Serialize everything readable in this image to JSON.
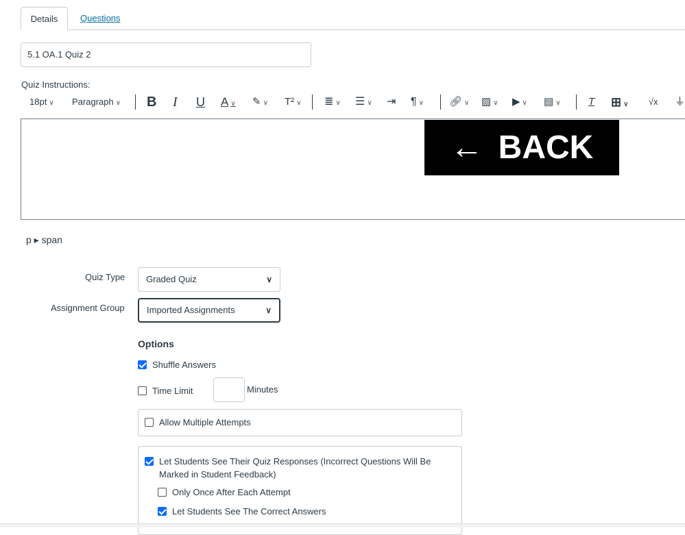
{
  "tabs": [
    {
      "label": "Details"
    },
    {
      "label": "Questions"
    }
  ],
  "quiz_title": "5.1 OA.1 Quiz 2",
  "instructions_label": "Quiz Instructions:",
  "toolbar": {
    "font_size": "18pt",
    "block_format": "Paragraph",
    "superscript": "T²",
    "math": "√x"
  },
  "editor": {
    "back_image_text": "BACK",
    "path": "p ▸ span"
  },
  "quiz_type": {
    "label": "Quiz Type",
    "value": "Graded Quiz"
  },
  "assignment_group": {
    "label": "Assignment Group",
    "value": "Imported Assignments"
  },
  "options": {
    "heading": "Options",
    "shuffle": {
      "label": "Shuffle Answers",
      "checked": true
    },
    "time_limit": {
      "label": "Time Limit",
      "value": "",
      "unit": "Minutes",
      "checked": false
    },
    "multiple_attempts": {
      "label": "Allow Multiple Attempts",
      "checked": false
    },
    "see_responses": {
      "label": "Let Students See Their Quiz Responses (Incorrect Questions Will Be Marked in Student Feedback)",
      "checked": true
    },
    "only_once": {
      "label": "Only Once After Each Attempt",
      "checked": false
    },
    "see_correct": {
      "label": "Let Students See The Correct Answers",
      "checked": true
    }
  },
  "colors": {
    "link": "#0770a3",
    "checkbox": "#0b6cff",
    "text": "#2d3b45"
  }
}
